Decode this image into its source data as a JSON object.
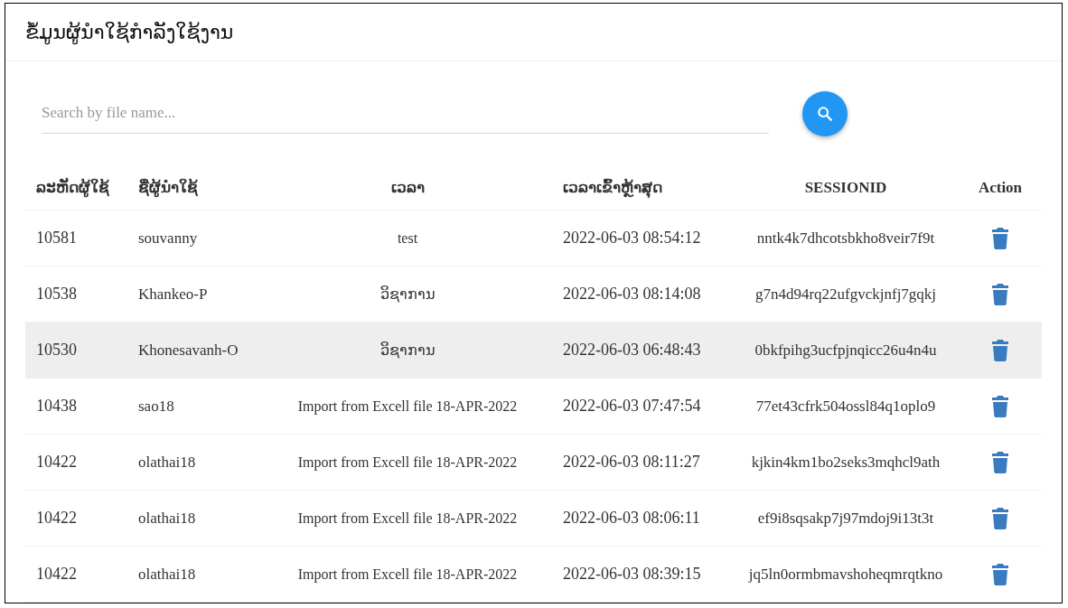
{
  "title": "ຂໍ້ມູນຜູ້ນຳໃຊ້ກຳລັງໃຊ້ງານ",
  "search": {
    "placeholder": "Search by file name..."
  },
  "table": {
    "columns": [
      "ລະຫັດຜູ້ໃຊ້",
      "ຊື່ຜູ້ນຳໃຊ້",
      "ເວລາ",
      "ເວລາເຂົ້າຫຼ້າສຸດ",
      "SESSIONID",
      "Action"
    ],
    "rows": [
      {
        "selected": false,
        "cells": [
          "10581",
          "souvanny",
          "test",
          "2022-06-03 08:54:12",
          "nntk4k7dhcotsbkho8veir7f9t"
        ]
      },
      {
        "selected": false,
        "cells": [
          "10538",
          "Khankeo-P",
          "ວິຊາການ",
          "2022-06-03 08:14:08",
          "g7n4d94rq22ufgvckjnfj7gqkj"
        ]
      },
      {
        "selected": true,
        "cells": [
          "10530",
          "Khonesavanh-O",
          "ວິຊາການ",
          "2022-06-03 06:48:43",
          "0bkfpihg3ucfpjnqicc26u4n4u"
        ]
      },
      {
        "selected": false,
        "cells": [
          "10438",
          "sao18",
          "Import from Excell file 18-APR-2022",
          "2022-06-03 07:47:54",
          "77et43cfrk504ossl84q1oplo9"
        ]
      },
      {
        "selected": false,
        "cells": [
          "10422",
          "olathai18",
          "Import from Excell file 18-APR-2022",
          "2022-06-03 08:11:27",
          "kjkin4km1bo2seks3mqhcl9ath"
        ]
      },
      {
        "selected": false,
        "cells": [
          "10422",
          "olathai18",
          "Import from Excell file 18-APR-2022",
          "2022-06-03 08:06:11",
          "ef9i8sqsakp7j97mdoj9i13t3t"
        ]
      },
      {
        "selected": false,
        "cells": [
          "10422",
          "olathai18",
          "Import from Excell file 18-APR-2022",
          "2022-06-03 08:39:15",
          "jq5ln0ormbmavshoheqmrqtkno"
        ]
      }
    ]
  }
}
